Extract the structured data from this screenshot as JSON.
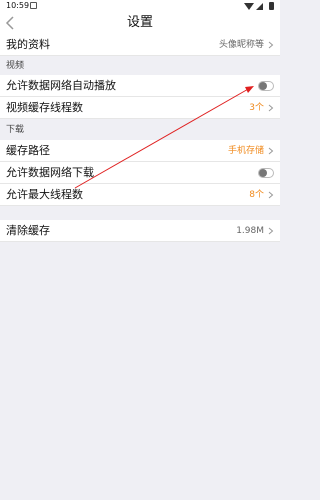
{
  "status_bar": {
    "time": "10:59"
  },
  "header": {
    "title": "设置"
  },
  "profile": {
    "label": "我的资料",
    "value": "头像昵称等"
  },
  "video_section": {
    "title": "视频",
    "items": [
      {
        "label": "允许数据网络自动播放",
        "toggle_on": false
      },
      {
        "label": "视频缓存线程数",
        "value": "3个"
      }
    ]
  },
  "download_section": {
    "title": "下载",
    "items": [
      {
        "label": "缓存路径",
        "value": "手机存储"
      },
      {
        "label": "允许数据网络下载",
        "toggle_on": false
      },
      {
        "label": "允许最大线程数",
        "value": "8个"
      }
    ]
  },
  "cache": {
    "label": "清除缓存",
    "value": "1.98M"
  },
  "colors": {
    "accent": "#f08a1d",
    "annotation_arrow": "#e02020"
  }
}
